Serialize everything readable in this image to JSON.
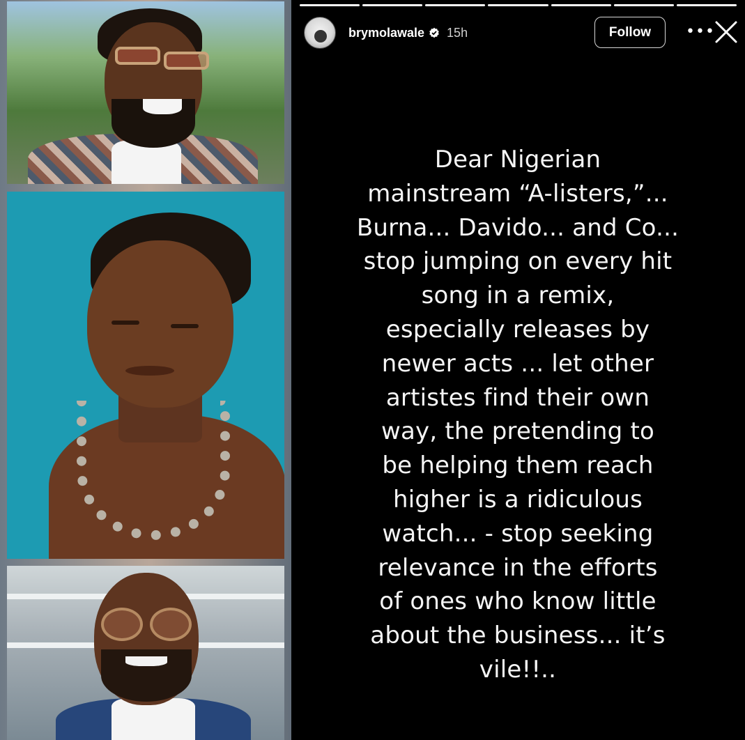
{
  "story": {
    "username": "brymolawale",
    "verified": true,
    "time_ago": "15h",
    "follow_label": "Follow",
    "more_icon": "more-horizontal-icon",
    "close_icon": "close-icon",
    "progress_segments_total": 7,
    "progress_segments_done": 7,
    "text": "Dear Nigerian\nmainstream “A-listers,”...\nBurna... Davido... and Co...\nstop jumping on every hit\nsong in a remix,\nespecially releases by\nnewer acts ... let other\nartistes find their own\nway, the pretending to\nbe helping them reach\nhigher is a ridiculous\nwatch... - stop seeking\nrelevance in the efforts\nof ones who know little\nabout the business... it’s\nvile!!.."
  },
  "collage": {
    "photos": [
      {
        "description_icon": "photo-man-sunglasses"
      },
      {
        "description_icon": "photo-man-necklace"
      },
      {
        "description_icon": "photo-man-round-glasses"
      }
    ]
  },
  "colors": {
    "story_bg": "#000000",
    "text": "#ffffff",
    "teal_backdrop": "#1d9bb2"
  }
}
